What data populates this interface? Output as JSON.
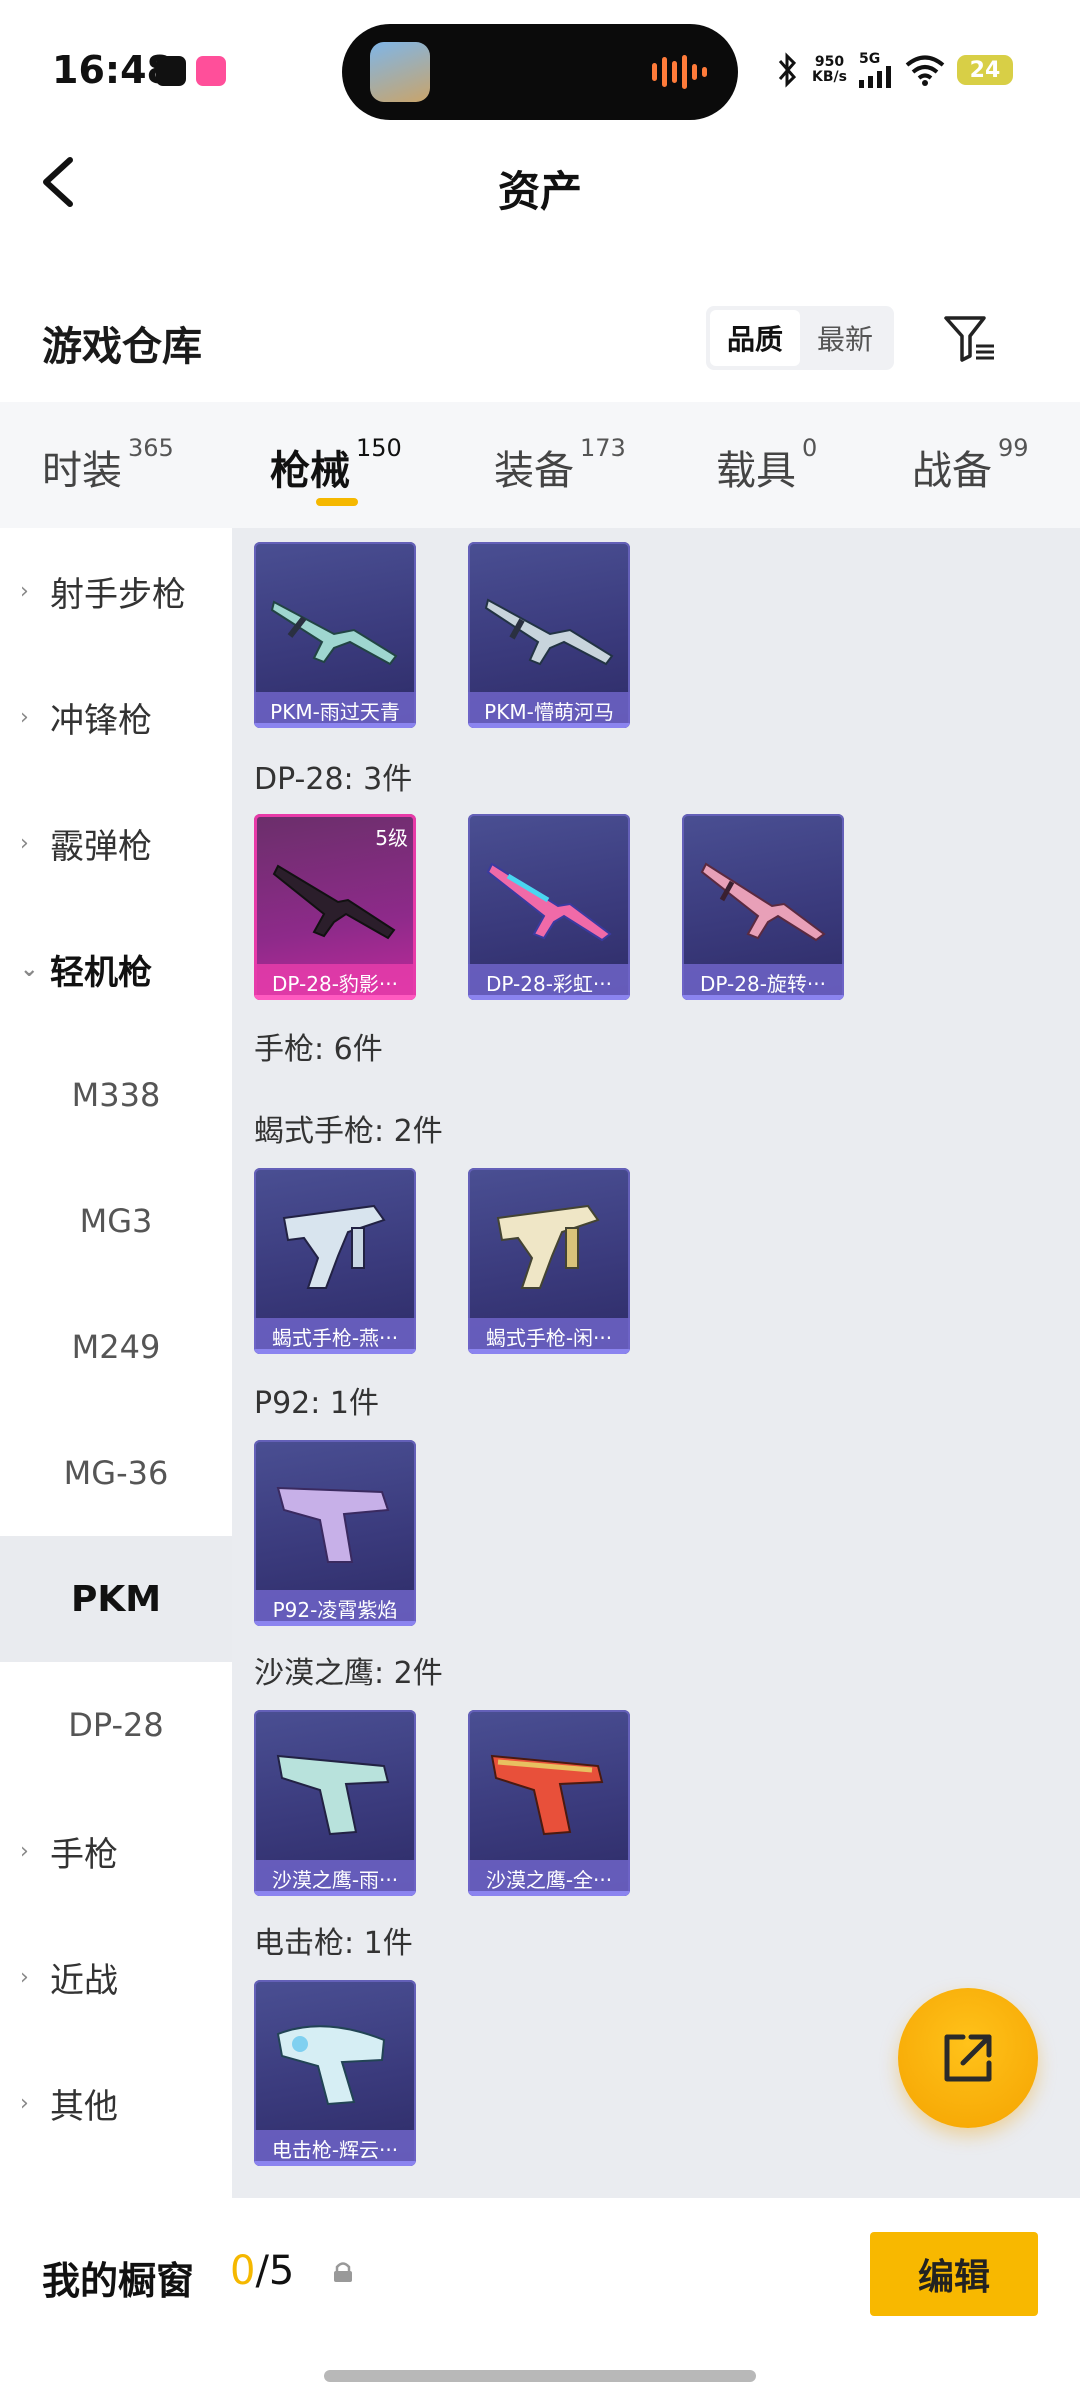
{
  "status_bar": {
    "time": "16:48",
    "speed_value": "950",
    "speed_unit": "KB/s",
    "network": "5G",
    "battery": "24",
    "icons": [
      "bluetooth-icon",
      "signal-icon",
      "wifi-icon",
      "battery-icon"
    ]
  },
  "header": {
    "title": "资产"
  },
  "warehouse": {
    "title": "游戏仓库",
    "sort_options": [
      "品质",
      "最新"
    ],
    "active_sort": "品质"
  },
  "tabs": [
    {
      "label": "时装",
      "count": "365"
    },
    {
      "label": "枪械",
      "count": "150"
    },
    {
      "label": "装备",
      "count": "173"
    },
    {
      "label": "载具",
      "count": "0"
    },
    {
      "label": "战备",
      "count": "99"
    }
  ],
  "active_tab": "枪械",
  "sidebar": {
    "items": [
      {
        "label": "射手步枪",
        "type": "category"
      },
      {
        "label": "冲锋枪",
        "type": "category"
      },
      {
        "label": "霰弹枪",
        "type": "category"
      },
      {
        "label": "轻机枪",
        "type": "category-open"
      },
      {
        "label": "M338",
        "type": "sub"
      },
      {
        "label": "MG3",
        "type": "sub"
      },
      {
        "label": "M249",
        "type": "sub"
      },
      {
        "label": "MG-36",
        "type": "sub"
      },
      {
        "label": "PKM",
        "type": "sub-selected"
      },
      {
        "label": "DP-28",
        "type": "sub"
      },
      {
        "label": "手枪",
        "type": "category"
      },
      {
        "label": "近战",
        "type": "category"
      },
      {
        "label": "其他",
        "type": "category"
      }
    ]
  },
  "content": {
    "groups": [
      {
        "title": "",
        "cards": [
          {
            "label": "PKM-雨过天青"
          },
          {
            "label": "PKM-懵萌河马"
          }
        ]
      },
      {
        "title": "DP-28: 3件",
        "cards": [
          {
            "label": "DP-28-豹影···",
            "level": "5级",
            "style": "pink"
          },
          {
            "label": "DP-28-彩虹···"
          },
          {
            "label": "DP-28-旋转···"
          }
        ]
      },
      {
        "title": "手枪: 6件",
        "cards": []
      },
      {
        "title": "蝎式手枪: 2件",
        "cards": [
          {
            "label": "蝎式手枪-燕···"
          },
          {
            "label": "蝎式手枪-闲···"
          }
        ]
      },
      {
        "title": "P92: 1件",
        "cards": [
          {
            "label": "P92-凌霄紫焰"
          }
        ]
      },
      {
        "title": "沙漠之鹰: 2件",
        "cards": [
          {
            "label": "沙漠之鹰-雨···"
          },
          {
            "label": "沙漠之鹰-全···"
          }
        ]
      },
      {
        "title": "电击枪: 1件",
        "cards": [
          {
            "label": "电击枪-辉云···"
          }
        ]
      }
    ]
  },
  "bottom": {
    "window_label": "我的橱窗",
    "window_current": "0",
    "window_total": "/5",
    "edit_label": "编辑"
  },
  "colors": {
    "accent": "#f8b800",
    "card_bg": "#3a3a7c",
    "card_label": "#6e64c8",
    "highlight_card": "#c1299b"
  }
}
